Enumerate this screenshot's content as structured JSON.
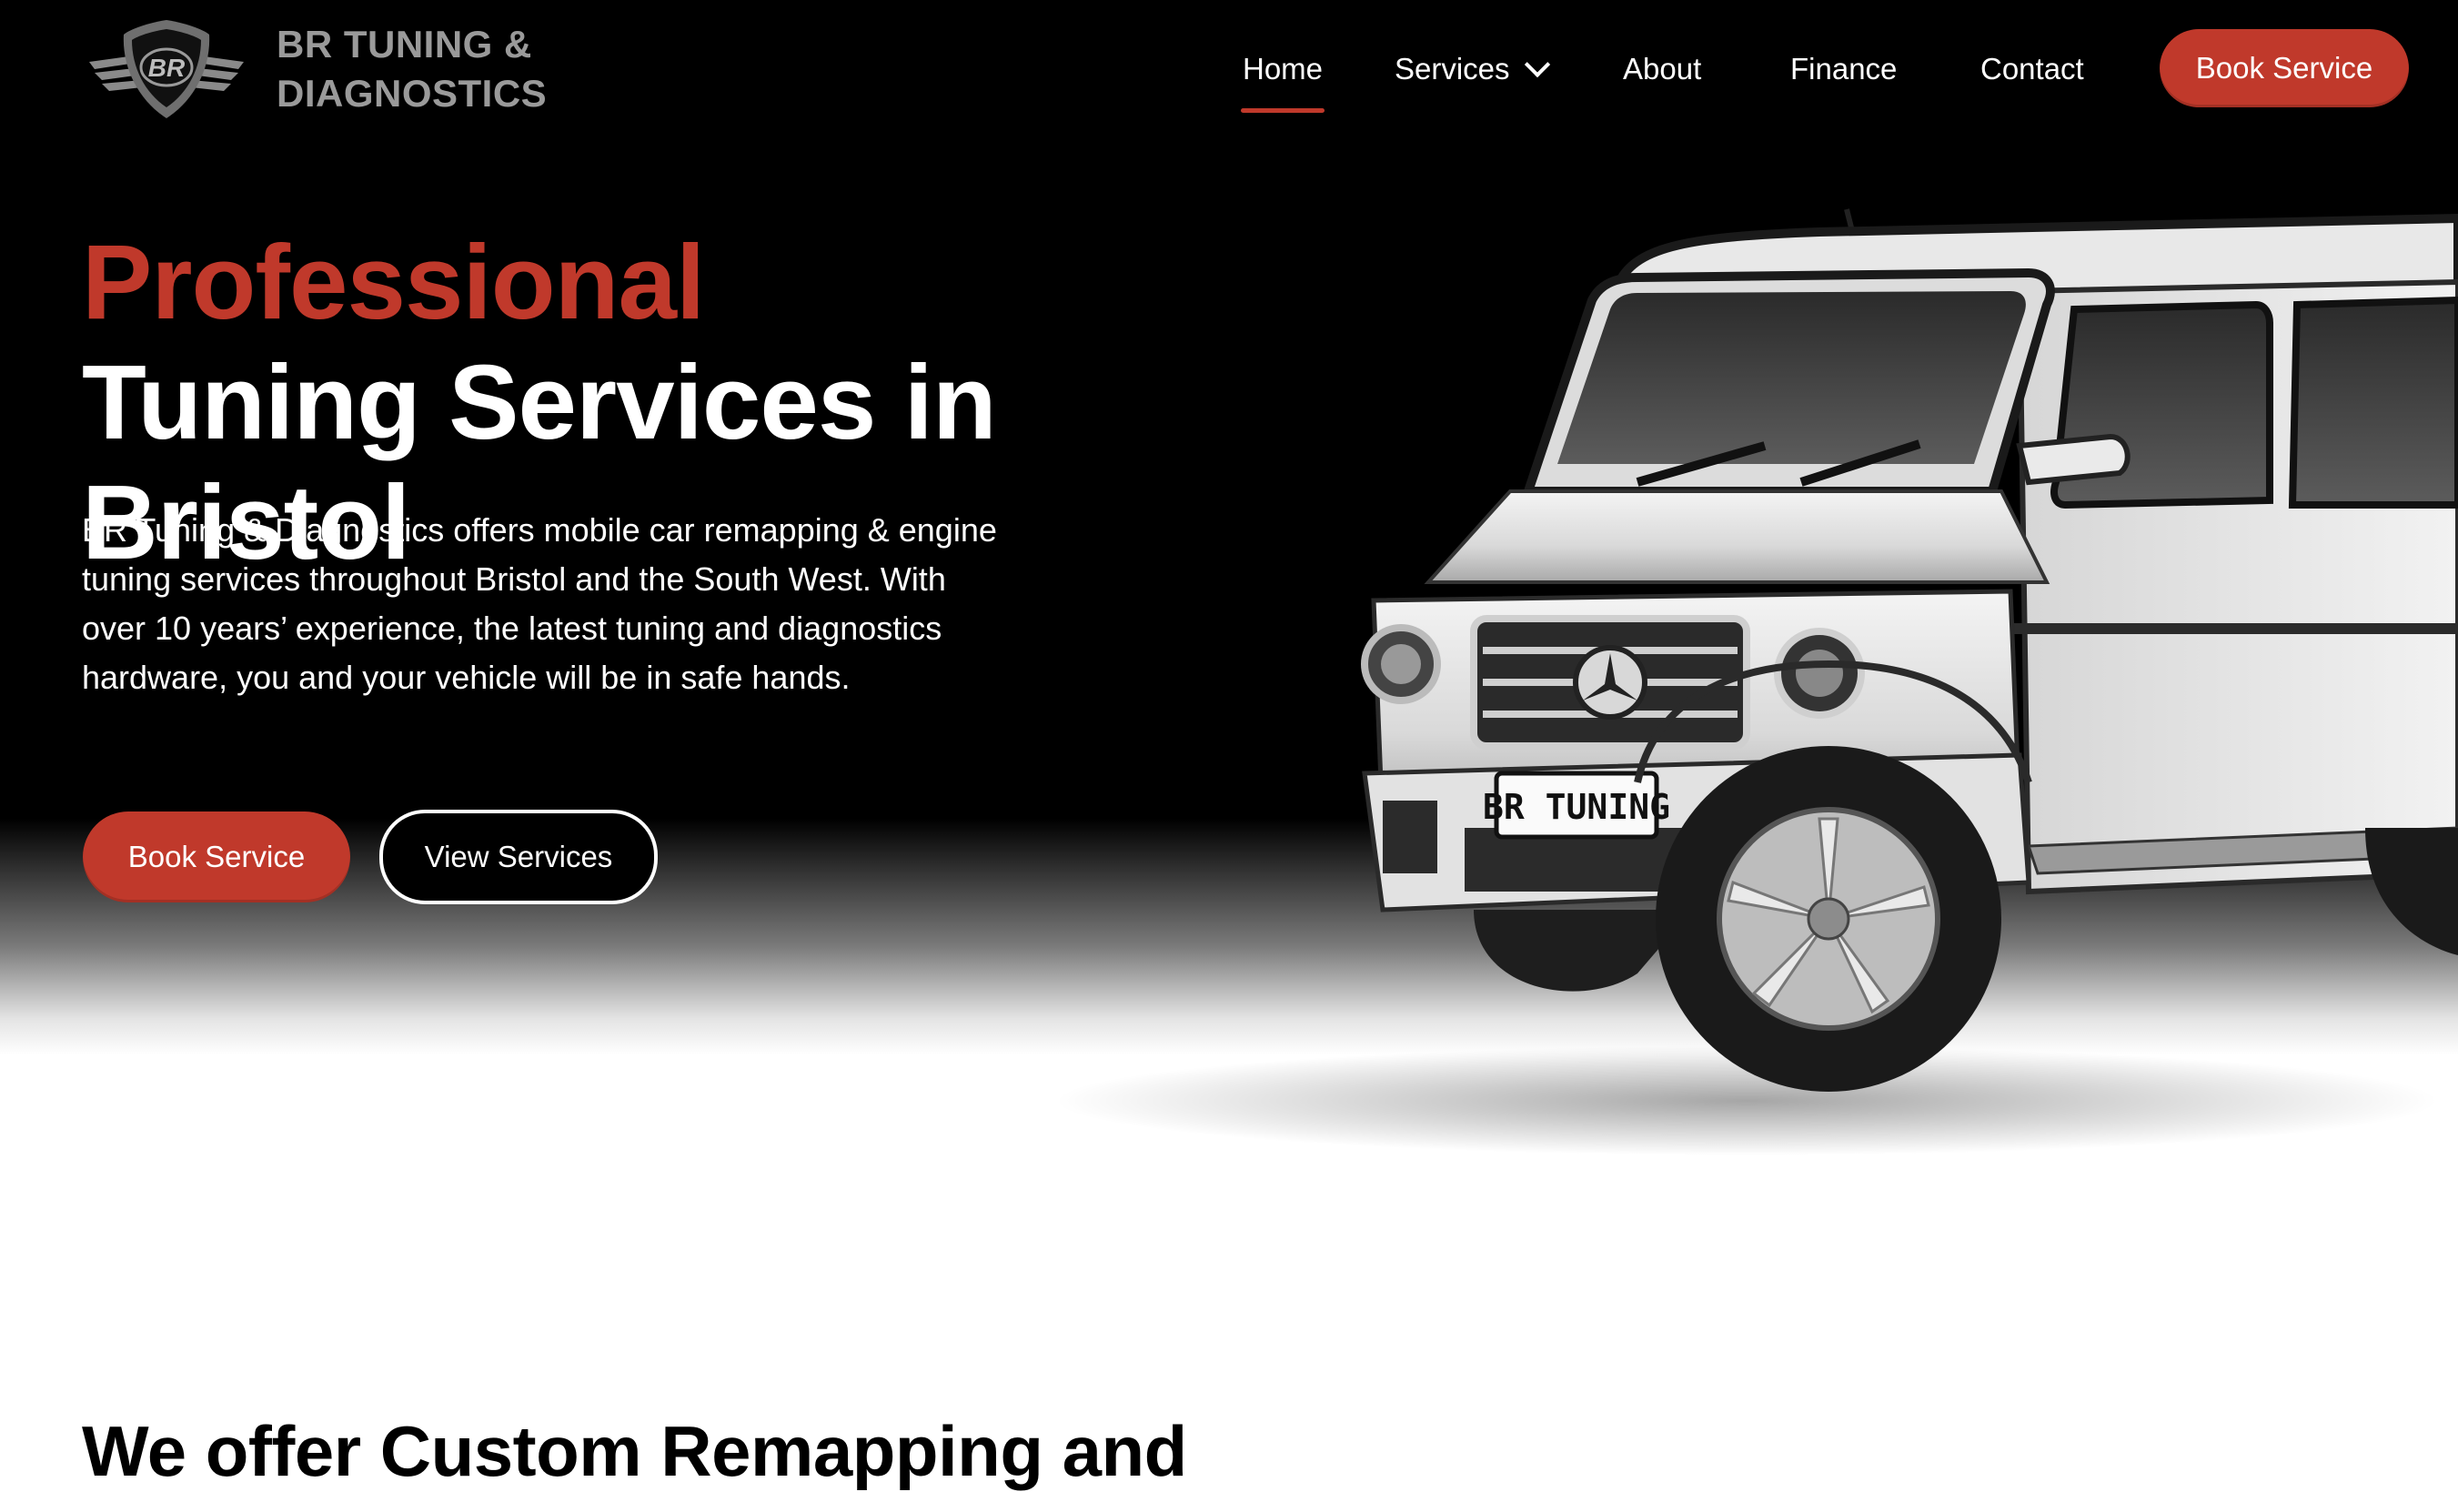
{
  "brand": {
    "line1": "BR TUNING &",
    "line2": "DIAGNOSTICS",
    "emblem_text": "BR"
  },
  "nav": {
    "items": [
      {
        "label": "Home",
        "active": true
      },
      {
        "label": "Services",
        "has_dropdown": true
      },
      {
        "label": "About"
      },
      {
        "label": "Finance"
      },
      {
        "label": "Contact"
      }
    ],
    "cta": "Book Service"
  },
  "hero": {
    "title_accent": "Professional",
    "title_rest": " Tuning Services in Bristol",
    "description": "BR Tuning & Diagnostics offers mobile car remapping & engine tuning services throughout Bristol and the South West. With over 10 years’ experience, the latest tuning and diagnostics hardware, you and your vehicle will be in safe hands.",
    "primary_button": "Book Service",
    "secondary_button": "View Services",
    "plate_text": "BR TUNING"
  },
  "section": {
    "heading": "We offer Custom Remapping and"
  },
  "colors": {
    "accent": "#c0392b",
    "hero_bg": "#000000",
    "page_bg": "#ffffff",
    "text_light": "#ffffff",
    "logo_text": "#9a9a9a"
  },
  "icons": [
    "logo-emblem-icon",
    "chevron-down-icon"
  ]
}
